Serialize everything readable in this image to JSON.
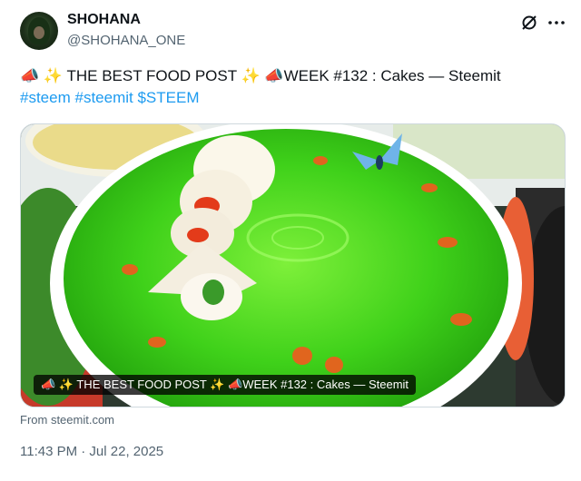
{
  "author": {
    "name": "SHOHANA",
    "handle": "@SHOHANA_ONE"
  },
  "icons": {
    "grok": "grok-icon",
    "more": "more-icon"
  },
  "tweet": {
    "line1": "📣 ✨ THE BEST FOOD POST ✨ 📣WEEK #132 : Cakes — Steemit",
    "hashtags": [
      "#steem",
      "#steemit",
      "$STEEM"
    ]
  },
  "card": {
    "title_overlay": "📣 ✨ THE BEST FOOD POST ✨ 📣WEEK #132 : Cakes — Steemit",
    "source": "From steemit.com"
  },
  "meta": {
    "timestamp": "11:43 PM · Jul 22, 2025"
  },
  "colors": {
    "link": "#1d9bf0",
    "secondary_text": "#536471",
    "cake_green": "#3fd11a"
  }
}
